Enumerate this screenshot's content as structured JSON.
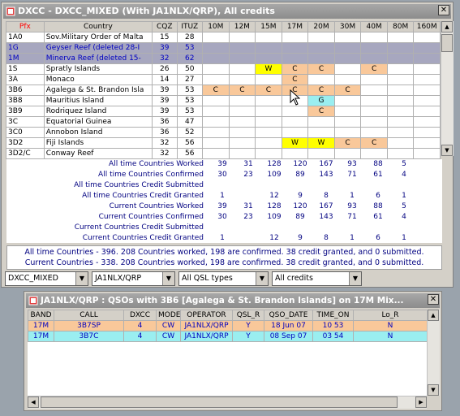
{
  "colors": {
    "orange": "#f9c89a",
    "yellow": "#ffff00",
    "cyan": "#9aeef0",
    "selected": "#a7a7bf",
    "red_header": "#ff0000",
    "blue_text": "#0000c0"
  },
  "dxcc_window": {
    "title": "DXCC - DXCC_MIXED (With JA1NLX/QRP), All credits",
    "headers": [
      "Pfx",
      "Country",
      "CQZ",
      "ITUZ",
      "10M",
      "12M",
      "15M",
      "17M",
      "20M",
      "30M",
      "40M",
      "80M",
      "160M"
    ],
    "rows": [
      {
        "pfx": "1A0",
        "country": "Sov.Military Order of Malta",
        "cqz": "15",
        "ituz": "28",
        "bands": [
          "",
          "",
          "",
          "",
          "",
          "",
          "",
          "",
          ""
        ],
        "style": "normal"
      },
      {
        "pfx": "1G",
        "country": "Geyser Reef  (deleted 28-I",
        "cqz": "39",
        "ituz": "53",
        "bands": [
          "",
          "",
          "",
          "",
          "",
          "",
          "",
          "",
          ""
        ],
        "style": "deleted"
      },
      {
        "pfx": "1M",
        "country": "Minerva Reef  (deleted 15-",
        "cqz": "32",
        "ituz": "62",
        "bands": [
          "",
          "",
          "",
          "",
          "",
          "",
          "",
          "",
          ""
        ],
        "style": "deleted"
      },
      {
        "pfx": "1S",
        "country": "Spratly Islands",
        "cqz": "26",
        "ituz": "50",
        "bands": [
          "",
          "",
          "W",
          "C",
          "C",
          "",
          "C",
          "",
          ""
        ],
        "style": "normal"
      },
      {
        "pfx": "3A",
        "country": "Monaco",
        "cqz": "14",
        "ituz": "27",
        "bands": [
          "",
          "",
          "",
          "C",
          "",
          "",
          "",
          "",
          ""
        ],
        "style": "normal"
      },
      {
        "pfx": "3B6",
        "country": "Agalega & St. Brandon Isla",
        "cqz": "39",
        "ituz": "53",
        "bands": [
          "C",
          "C",
          "C",
          "C",
          "C",
          "C",
          "",
          "",
          ""
        ],
        "style": "normal"
      },
      {
        "pfx": "3B8",
        "country": "Mauritius Island",
        "cqz": "39",
        "ituz": "53",
        "bands": [
          "",
          "",
          "",
          "",
          "G",
          "",
          "",
          "",
          ""
        ],
        "style": "normal"
      },
      {
        "pfx": "3B9",
        "country": "Rodriquez Island",
        "cqz": "39",
        "ituz": "53",
        "bands": [
          "",
          "",
          "",
          "",
          "C",
          "",
          "",
          "",
          ""
        ],
        "style": "normal"
      },
      {
        "pfx": "3C",
        "country": "Equatorial Guinea",
        "cqz": "36",
        "ituz": "47",
        "bands": [
          "",
          "",
          "",
          "",
          "",
          "",
          "",
          "",
          ""
        ],
        "style": "normal"
      },
      {
        "pfx": "3C0",
        "country": "Annobon Island",
        "cqz": "36",
        "ituz": "52",
        "bands": [
          "",
          "",
          "",
          "",
          "",
          "",
          "",
          "",
          ""
        ],
        "style": "normal"
      },
      {
        "pfx": "3D2",
        "country": "Fiji Islands",
        "cqz": "32",
        "ituz": "56",
        "bands": [
          "",
          "",
          "",
          "W",
          "W",
          "C",
          "C",
          "",
          ""
        ],
        "style": "normal"
      },
      {
        "pfx": "3D2/C",
        "country": "Conway Reef",
        "cqz": "32",
        "ituz": "56",
        "bands": [
          "",
          "",
          "",
          "",
          "",
          "",
          "",
          "",
          ""
        ],
        "style": "normal"
      }
    ],
    "summary": [
      {
        "label": "All time Countries Worked",
        "values": [
          "39",
          "31",
          "128",
          "120",
          "167",
          "93",
          "88",
          "5",
          ""
        ]
      },
      {
        "label": "All time Countries Confirmed",
        "values": [
          "30",
          "23",
          "109",
          "89",
          "143",
          "71",
          "61",
          "4",
          ""
        ]
      },
      {
        "label": "All time Countries Credit Submitted",
        "values": [
          "",
          "",
          "",
          "",
          "",
          "",
          "",
          "",
          ""
        ]
      },
      {
        "label": "All time Countries Credit Granted",
        "values": [
          "1",
          "",
          "12",
          "9",
          "8",
          "1",
          "6",
          "1",
          ""
        ]
      },
      {
        "label": "Current Countries Worked",
        "values": [
          "39",
          "31",
          "128",
          "120",
          "167",
          "93",
          "88",
          "5",
          ""
        ]
      },
      {
        "label": "Current Countries Confirmed",
        "values": [
          "30",
          "23",
          "109",
          "89",
          "143",
          "71",
          "61",
          "4",
          ""
        ]
      },
      {
        "label": "Current Countries Credit Submitted",
        "values": [
          "",
          "",
          "",
          "",
          "",
          "",
          "",
          "",
          ""
        ]
      },
      {
        "label": "Current Countries Credit Granted",
        "values": [
          "1",
          "",
          "12",
          "9",
          "8",
          "1",
          "6",
          "1",
          ""
        ]
      }
    ],
    "status": [
      "All time Countries - 396.  208 Countries worked, 198 are confirmed. 38 credit granted, and 0 submitted.",
      "Current Countries - 338.  208 Countries worked, 198 are confirmed. 38 credit granted, and 0 submitted."
    ],
    "filters": [
      "DXCC_MIXED",
      "JA1NLX/QRP",
      "All QSL types",
      "All credits"
    ]
  },
  "qso_window": {
    "title": "JA1NLX/QRP : QSOs with 3B6 [Agalega & St. Brandon Islands] on 17M Mix...",
    "headers": [
      "BAND",
      "CALL",
      "DXCC",
      "MODE",
      "OPERATOR",
      "QSL_R",
      "QSO_DATE",
      "TIME_ON",
      "Lo_R"
    ],
    "rows": [
      {
        "band": "17M",
        "call": "3B7SP",
        "dxcc": "4",
        "mode": "CW",
        "operator": "JA1NLX/QRP",
        "qsl": "Y",
        "date": "18 Jun 07",
        "time": "10 53",
        "lo": "N",
        "style": "orange"
      },
      {
        "band": "17M",
        "call": "3B7C",
        "dxcc": "4",
        "mode": "CW",
        "operator": "JA1NLX/QRP",
        "qsl": "Y",
        "date": "08 Sep 07",
        "time": "03 54",
        "lo": "N",
        "style": "cyan"
      }
    ]
  }
}
